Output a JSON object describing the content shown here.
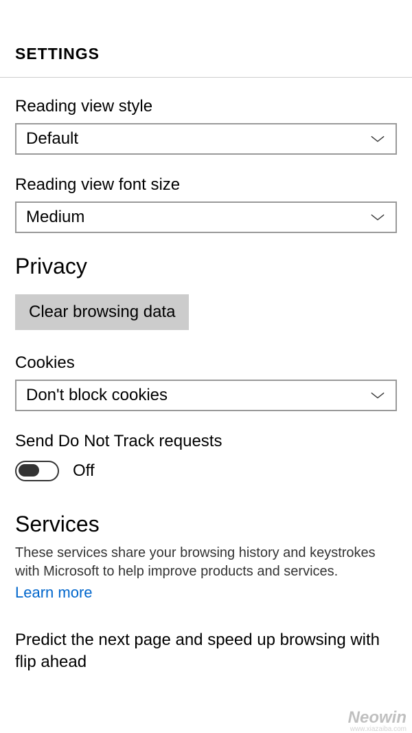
{
  "header": {
    "title": "SETTINGS"
  },
  "reading_style": {
    "label": "Reading view style",
    "value": "Default"
  },
  "reading_font": {
    "label": "Reading view font size",
    "value": "Medium"
  },
  "privacy": {
    "title": "Privacy",
    "clear_button": "Clear browsing data",
    "cookies_label": "Cookies",
    "cookies_value": "Don't block cookies",
    "dnt_label": "Send Do Not Track requests",
    "dnt_state": "Off"
  },
  "services": {
    "title": "Services",
    "description": "These services share your browsing history and keystrokes with Microsoft to help improve products and services.",
    "learn_more": "Learn more",
    "predict_label": "Predict the next page and speed up browsing with flip ahead"
  },
  "watermark": {
    "text": "Neowin",
    "sub": "www.xiazaiba.com"
  }
}
